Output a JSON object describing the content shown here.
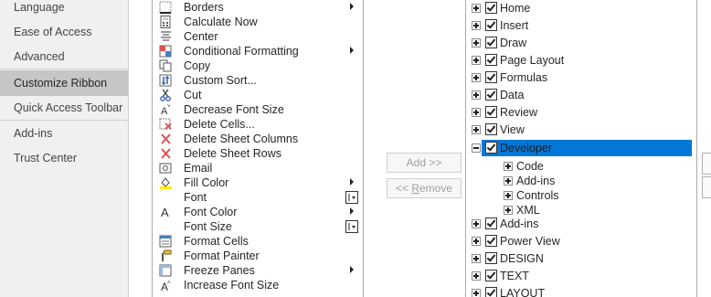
{
  "nav": {
    "items": [
      {
        "label": "Language"
      },
      {
        "label": "Ease of Access"
      },
      {
        "label": "Advanced"
      },
      {
        "label": "Customize Ribbon"
      },
      {
        "label": "Quick Access Toolbar"
      },
      {
        "label": "Add-ins"
      },
      {
        "label": "Trust Center"
      }
    ]
  },
  "commands": [
    {
      "label": "Borders",
      "icon": "borders-icon"
    },
    {
      "label": "Calculate Now",
      "icon": "calculator-icon"
    },
    {
      "label": "Center",
      "icon": "center-align-icon"
    },
    {
      "label": "Conditional Formatting",
      "icon": "conditional-formatting-icon"
    },
    {
      "label": "Copy",
      "icon": "copy-icon"
    },
    {
      "label": "Custom Sort...",
      "icon": "sort-icon"
    },
    {
      "label": "Cut",
      "icon": "scissors-icon"
    },
    {
      "label": "Decrease Font Size",
      "icon": "decrease-font-icon"
    },
    {
      "label": "Delete Cells...",
      "icon": "delete-cells-icon"
    },
    {
      "label": "Delete Sheet Columns",
      "icon": "delete-columns-icon"
    },
    {
      "label": "Delete Sheet Rows",
      "icon": "delete-rows-icon"
    },
    {
      "label": "Email",
      "icon": "email-icon"
    },
    {
      "label": "Fill Color",
      "icon": "fill-color-icon"
    },
    {
      "label": "Font",
      "icon": "none"
    },
    {
      "label": "Font Color",
      "icon": "font-color-icon"
    },
    {
      "label": "Font Size",
      "icon": "none"
    },
    {
      "label": "Format Cells",
      "icon": "format-cells-icon"
    },
    {
      "label": "Format Painter",
      "icon": "format-painter-icon"
    },
    {
      "label": "Freeze Panes",
      "icon": "freeze-panes-icon"
    },
    {
      "label": "Increase Font Size",
      "icon": "increase-font-icon"
    }
  ],
  "buttons": {
    "add_label": "Add >>",
    "remove_label_pre": "<< ",
    "remove_label_u": "R",
    "remove_label_post": "emove"
  },
  "tree": [
    {
      "label": "Home"
    },
    {
      "label": "Insert"
    },
    {
      "label": "Draw"
    },
    {
      "label": "Page Layout"
    },
    {
      "label": "Formulas"
    },
    {
      "label": "Data"
    },
    {
      "label": "Review"
    },
    {
      "label": "View"
    },
    {
      "label": "Developer"
    },
    {
      "label": "Code"
    },
    {
      "label": "Add-ins"
    },
    {
      "label": "Controls"
    },
    {
      "label": "XML"
    },
    {
      "label": "Add-ins"
    },
    {
      "label": "Power View"
    },
    {
      "label": "DESIGN"
    },
    {
      "label": "TEXT"
    },
    {
      "label": "LAYOUT"
    }
  ],
  "colors": {
    "selection": "#0078d7",
    "nav_selected": "#c6c6c6"
  }
}
